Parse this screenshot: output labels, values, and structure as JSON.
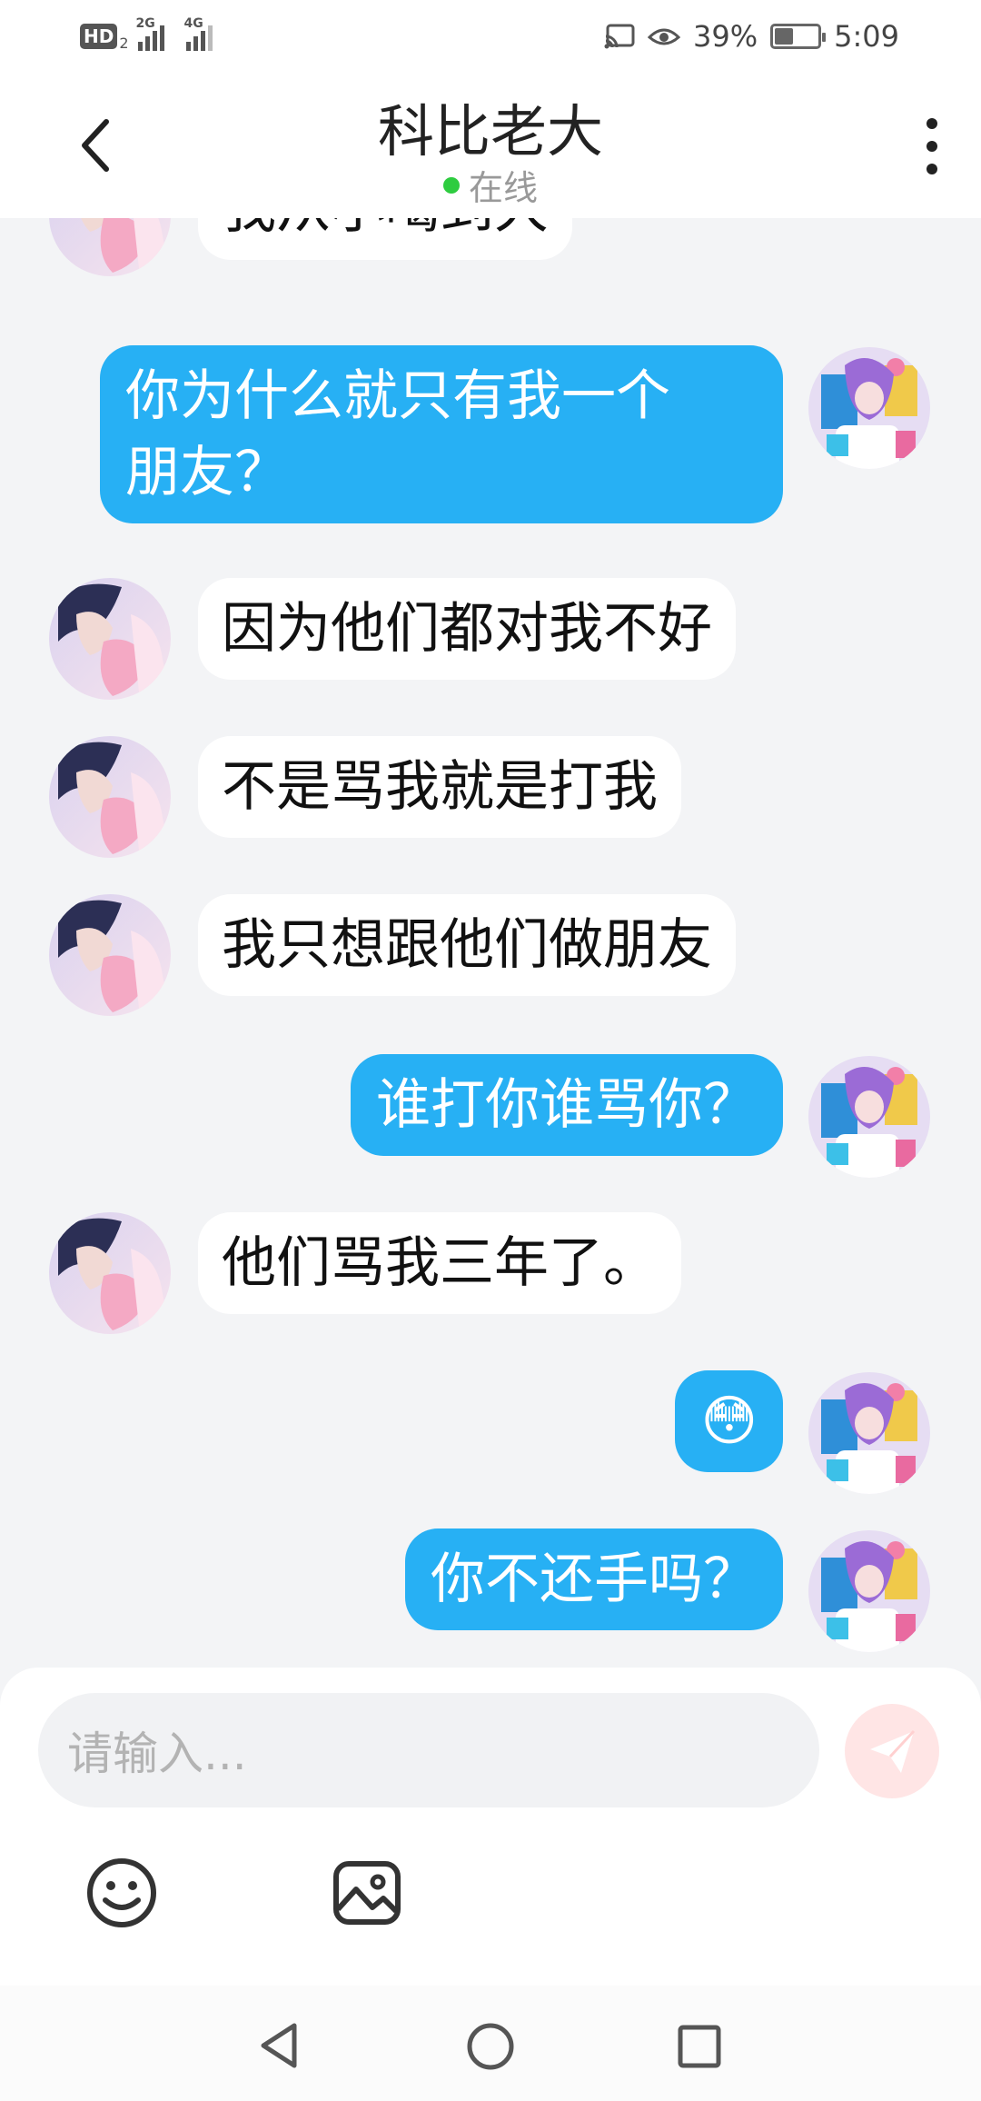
{
  "status_bar": {
    "hd_label": "HD",
    "hd_sub": "2",
    "sim1_network": "2G",
    "sim2_network": "4G",
    "battery_percent": "39%",
    "battery_level": 0.39,
    "time": "5:09"
  },
  "header": {
    "title": "科比老大",
    "presence_text": "在线",
    "presence_color": "#2ecc40"
  },
  "messages": [
    {
      "direction": "in",
      "text": "我从小喝到大"
    },
    {
      "direction": "out",
      "text": "你为什么就只有我一个\n朋友？"
    },
    {
      "direction": "in",
      "text": "因为他们都对我不好"
    },
    {
      "direction": "in",
      "text": "不是骂我就是打我"
    },
    {
      "direction": "in",
      "text": "我只想跟他们做朋友"
    },
    {
      "direction": "out",
      "text": "谁打你谁骂你？"
    },
    {
      "direction": "in",
      "text": "他们骂我三年了。"
    },
    {
      "direction": "out",
      "text": "😳"
    },
    {
      "direction": "out",
      "text": "你不还手吗？"
    }
  ],
  "composer": {
    "placeholder": "请输入..."
  },
  "colors": {
    "outgoing_bubble": "#27b0f4",
    "incoming_bubble": "#ffffff",
    "background": "#f3f4f6",
    "send_button": "#ffe5e5"
  },
  "icons": {
    "back": "chevron-left-icon",
    "more": "more-vertical-icon",
    "send": "send-icon",
    "emoji": "smiley-icon",
    "image": "image-icon",
    "nav_back": "triangle-back-icon",
    "nav_home": "circle-home-icon",
    "nav_recent": "square-recent-icon"
  }
}
